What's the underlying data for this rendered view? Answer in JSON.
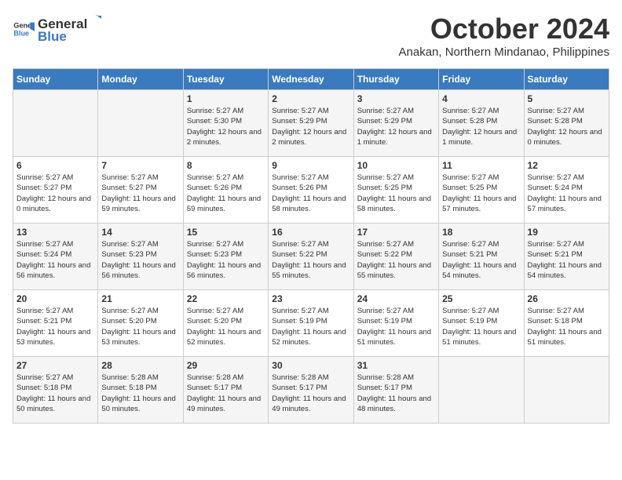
{
  "header": {
    "logo_general": "General",
    "logo_blue": "Blue",
    "month": "October 2024",
    "location": "Anakan, Northern Mindanao, Philippines"
  },
  "days_of_week": [
    "Sunday",
    "Monday",
    "Tuesday",
    "Wednesday",
    "Thursday",
    "Friday",
    "Saturday"
  ],
  "weeks": [
    [
      {
        "day": "",
        "content": ""
      },
      {
        "day": "",
        "content": ""
      },
      {
        "day": "1",
        "content": "Sunrise: 5:27 AM\nSunset: 5:30 PM\nDaylight: 12 hours and 2 minutes."
      },
      {
        "day": "2",
        "content": "Sunrise: 5:27 AM\nSunset: 5:29 PM\nDaylight: 12 hours and 2 minutes."
      },
      {
        "day": "3",
        "content": "Sunrise: 5:27 AM\nSunset: 5:29 PM\nDaylight: 12 hours and 1 minute."
      },
      {
        "day": "4",
        "content": "Sunrise: 5:27 AM\nSunset: 5:28 PM\nDaylight: 12 hours and 1 minute."
      },
      {
        "day": "5",
        "content": "Sunrise: 5:27 AM\nSunset: 5:28 PM\nDaylight: 12 hours and 0 minutes."
      }
    ],
    [
      {
        "day": "6",
        "content": "Sunrise: 5:27 AM\nSunset: 5:27 PM\nDaylight: 12 hours and 0 minutes."
      },
      {
        "day": "7",
        "content": "Sunrise: 5:27 AM\nSunset: 5:27 PM\nDaylight: 11 hours and 59 minutes."
      },
      {
        "day": "8",
        "content": "Sunrise: 5:27 AM\nSunset: 5:26 PM\nDaylight: 11 hours and 59 minutes."
      },
      {
        "day": "9",
        "content": "Sunrise: 5:27 AM\nSunset: 5:26 PM\nDaylight: 11 hours and 58 minutes."
      },
      {
        "day": "10",
        "content": "Sunrise: 5:27 AM\nSunset: 5:25 PM\nDaylight: 11 hours and 58 minutes."
      },
      {
        "day": "11",
        "content": "Sunrise: 5:27 AM\nSunset: 5:25 PM\nDaylight: 11 hours and 57 minutes."
      },
      {
        "day": "12",
        "content": "Sunrise: 5:27 AM\nSunset: 5:24 PM\nDaylight: 11 hours and 57 minutes."
      }
    ],
    [
      {
        "day": "13",
        "content": "Sunrise: 5:27 AM\nSunset: 5:24 PM\nDaylight: 11 hours and 56 minutes."
      },
      {
        "day": "14",
        "content": "Sunrise: 5:27 AM\nSunset: 5:23 PM\nDaylight: 11 hours and 56 minutes."
      },
      {
        "day": "15",
        "content": "Sunrise: 5:27 AM\nSunset: 5:23 PM\nDaylight: 11 hours and 56 minutes."
      },
      {
        "day": "16",
        "content": "Sunrise: 5:27 AM\nSunset: 5:22 PM\nDaylight: 11 hours and 55 minutes."
      },
      {
        "day": "17",
        "content": "Sunrise: 5:27 AM\nSunset: 5:22 PM\nDaylight: 11 hours and 55 minutes."
      },
      {
        "day": "18",
        "content": "Sunrise: 5:27 AM\nSunset: 5:21 PM\nDaylight: 11 hours and 54 minutes."
      },
      {
        "day": "19",
        "content": "Sunrise: 5:27 AM\nSunset: 5:21 PM\nDaylight: 11 hours and 54 minutes."
      }
    ],
    [
      {
        "day": "20",
        "content": "Sunrise: 5:27 AM\nSunset: 5:21 PM\nDaylight: 11 hours and 53 minutes."
      },
      {
        "day": "21",
        "content": "Sunrise: 5:27 AM\nSunset: 5:20 PM\nDaylight: 11 hours and 53 minutes."
      },
      {
        "day": "22",
        "content": "Sunrise: 5:27 AM\nSunset: 5:20 PM\nDaylight: 11 hours and 52 minutes."
      },
      {
        "day": "23",
        "content": "Sunrise: 5:27 AM\nSunset: 5:19 PM\nDaylight: 11 hours and 52 minutes."
      },
      {
        "day": "24",
        "content": "Sunrise: 5:27 AM\nSunset: 5:19 PM\nDaylight: 11 hours and 51 minutes."
      },
      {
        "day": "25",
        "content": "Sunrise: 5:27 AM\nSunset: 5:19 PM\nDaylight: 11 hours and 51 minutes."
      },
      {
        "day": "26",
        "content": "Sunrise: 5:27 AM\nSunset: 5:18 PM\nDaylight: 11 hours and 51 minutes."
      }
    ],
    [
      {
        "day": "27",
        "content": "Sunrise: 5:27 AM\nSunset: 5:18 PM\nDaylight: 11 hours and 50 minutes."
      },
      {
        "day": "28",
        "content": "Sunrise: 5:28 AM\nSunset: 5:18 PM\nDaylight: 11 hours and 50 minutes."
      },
      {
        "day": "29",
        "content": "Sunrise: 5:28 AM\nSunset: 5:17 PM\nDaylight: 11 hours and 49 minutes."
      },
      {
        "day": "30",
        "content": "Sunrise: 5:28 AM\nSunset: 5:17 PM\nDaylight: 11 hours and 49 minutes."
      },
      {
        "day": "31",
        "content": "Sunrise: 5:28 AM\nSunset: 5:17 PM\nDaylight: 11 hours and 48 minutes."
      },
      {
        "day": "",
        "content": ""
      },
      {
        "day": "",
        "content": ""
      }
    ]
  ]
}
